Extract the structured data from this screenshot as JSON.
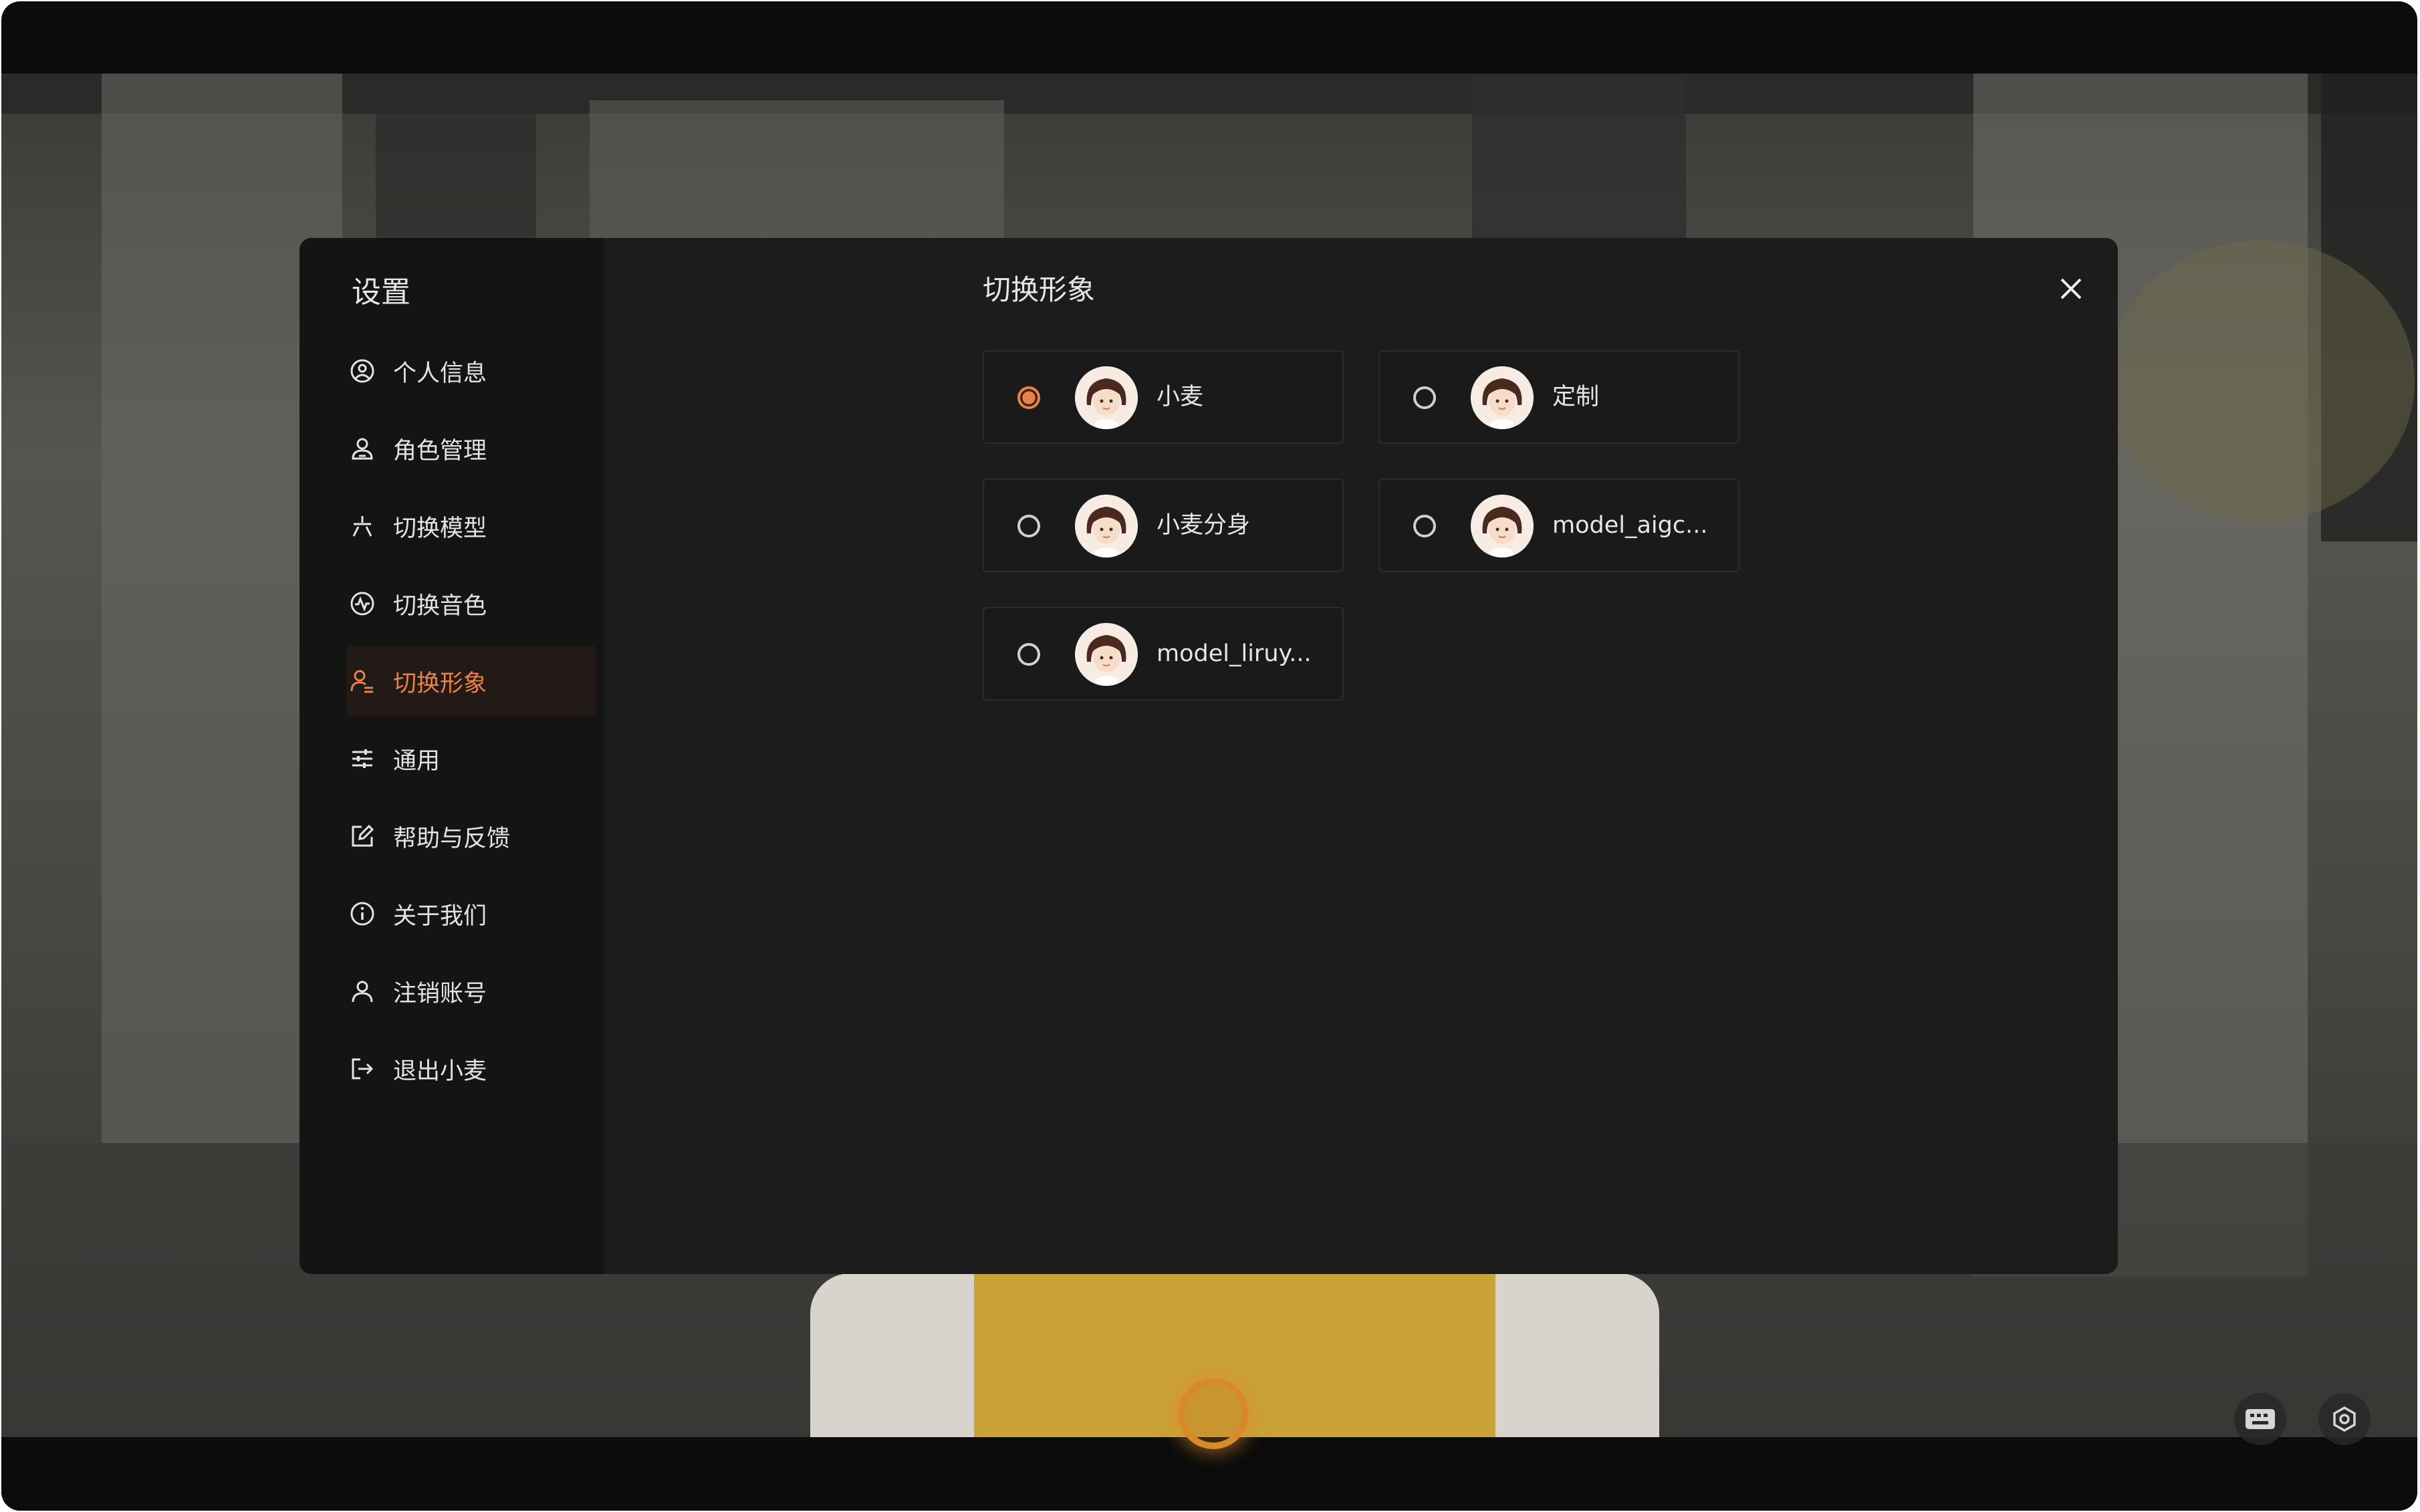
{
  "colors": {
    "accent": "#e8824a",
    "modal_bg": "#1c1c1c",
    "sidebar_bg": "#141414"
  },
  "sidebar": {
    "title": "设置",
    "items": [
      {
        "label": "个人信息",
        "icon": "user-circle-icon",
        "active": false
      },
      {
        "label": "角色管理",
        "icon": "user-badge-icon",
        "active": false
      },
      {
        "label": "切换模型",
        "icon": "sparkle-icon",
        "active": false
      },
      {
        "label": "切换音色",
        "icon": "sound-icon",
        "active": false
      },
      {
        "label": "切换形象",
        "icon": "avatar-switch-icon",
        "active": true
      },
      {
        "label": "通用",
        "icon": "sliders-icon",
        "active": false
      },
      {
        "label": "帮助与反馈",
        "icon": "edit-icon",
        "active": false
      },
      {
        "label": "关于我们",
        "icon": "info-icon",
        "active": false
      },
      {
        "label": "注销账号",
        "icon": "user-icon",
        "active": false
      },
      {
        "label": "退出小麦",
        "icon": "logout-icon",
        "active": false
      }
    ]
  },
  "content": {
    "title": "切换形象",
    "options": [
      {
        "label": "小麦",
        "selected": true
      },
      {
        "label": "定制",
        "selected": false
      },
      {
        "label": "小麦分身",
        "selected": false
      },
      {
        "label": "model_aigc...",
        "selected": false
      },
      {
        "label": "model_liruy...",
        "selected": false
      }
    ]
  },
  "bottom_controls": {
    "keyboard_icon": "keyboard-icon",
    "settings_icon": "settings-icon",
    "mic_icon": "mic-ring-icon"
  }
}
